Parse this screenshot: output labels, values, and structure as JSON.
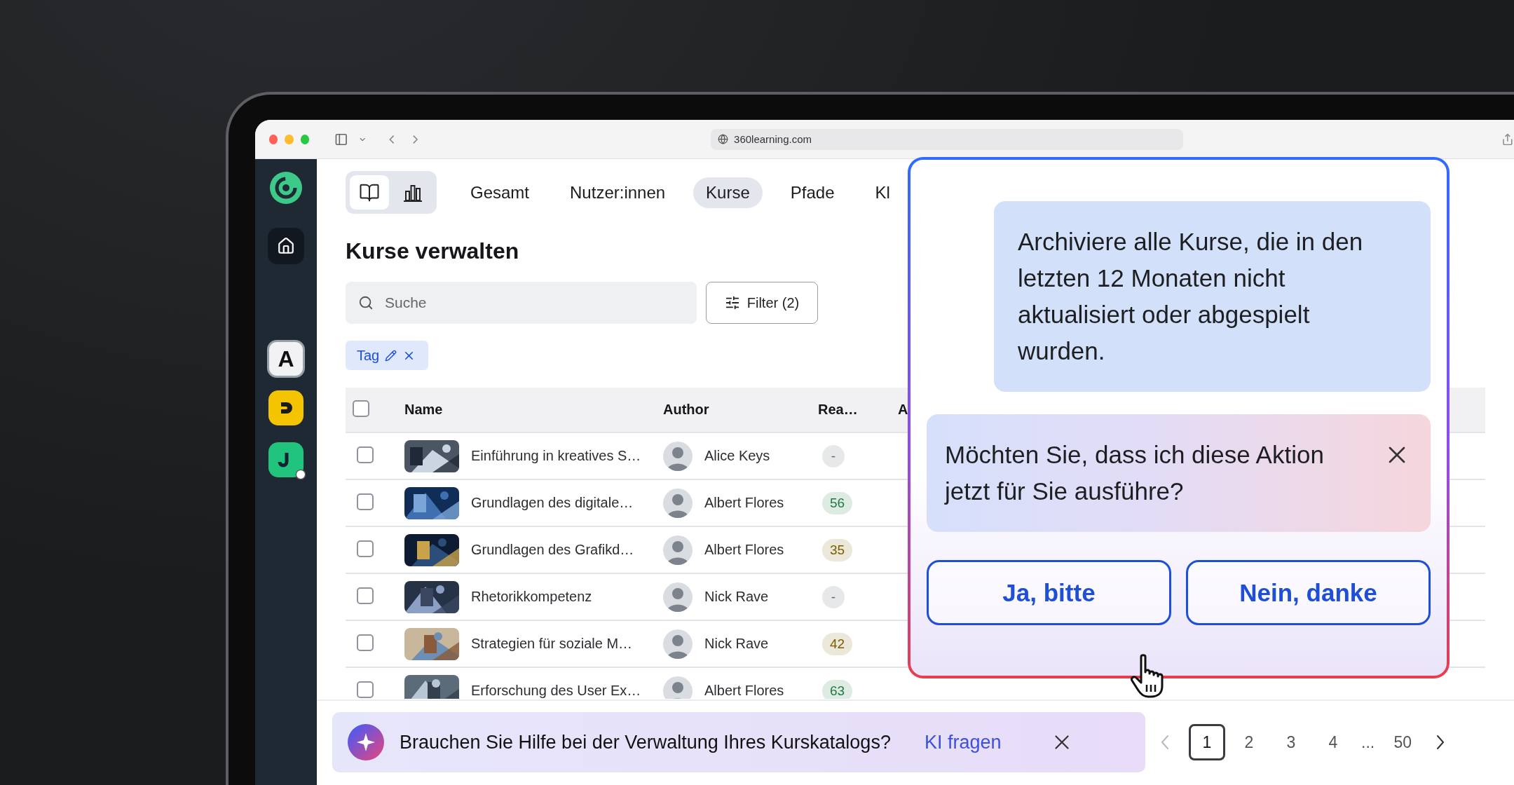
{
  "browser": {
    "url": "360learning.com"
  },
  "sidebar": {
    "app_tile_label": "A"
  },
  "view_toggle": [
    {
      "selected": true
    },
    {
      "selected": false
    }
  ],
  "tabs": [
    {
      "label": "Gesamt",
      "selected": false
    },
    {
      "label": "Nutzer:innen",
      "selected": false
    },
    {
      "label": "Kurse",
      "selected": true
    },
    {
      "label": "Pfade",
      "selected": false
    },
    {
      "label": "Kl",
      "selected": false
    }
  ],
  "page_title": "Kurse verwalten",
  "search": {
    "placeholder": "Suche"
  },
  "filter_button": "Filter (2)",
  "active_filters": [
    {
      "label": "Tag"
    }
  ],
  "table": {
    "columns": [
      "Name",
      "Author",
      "Rea…",
      "A"
    ],
    "select_all": {
      "checked": false
    },
    "rows": [
      {
        "checked": false,
        "name": "Einführung in kreatives S…",
        "author": "Alice Keys",
        "reach": "-",
        "color": "#5f636b"
      },
      {
        "checked": false,
        "name": "Grundlagen des digitale…",
        "author": "Albert Flores",
        "reach": "56",
        "color": "#1f7a45"
      },
      {
        "checked": false,
        "name": "Grundlagen des Grafikd…",
        "author": "Albert Flores",
        "reach": "35",
        "color": "#7a5d00"
      },
      {
        "checked": false,
        "name": "Rhetorikkompetenz",
        "author": "Nick Rave",
        "reach": "-",
        "color": "#5f636b"
      },
      {
        "checked": false,
        "name": "Strategien für soziale M…",
        "author": "Nick Rave",
        "reach": "42",
        "color": "#7a5d00"
      },
      {
        "checked": false,
        "name": "Erforschung des User Ex…",
        "author": "Albert Flores",
        "reach": "63",
        "color": "#1f7a45"
      }
    ]
  },
  "assistant": {
    "prompt": "Archiviere alle Kurse, die in den letzten 12 Monaten nicht aktualisiert oder abgespielt wurden.",
    "question": "Möchten Sie, dass ich diese Aktion jetzt für Sie ausführe?",
    "actions": [
      "Ja, bitte",
      "Nein, danke"
    ]
  },
  "help_banner": {
    "text": "Brauchen Sie Hilfe bei der Verwaltung Ihres Kurskatalogs?",
    "link": "KI fragen"
  },
  "pagination": {
    "prev_disabled": true,
    "next_disabled": false,
    "ellipsis": "...",
    "pages": [
      {
        "label": "1",
        "selected": true
      },
      {
        "label": "2",
        "selected": false
      },
      {
        "label": "3",
        "selected": false
      },
      {
        "label": "4",
        "selected": false
      },
      {
        "label": "50",
        "selected": false
      }
    ]
  }
}
